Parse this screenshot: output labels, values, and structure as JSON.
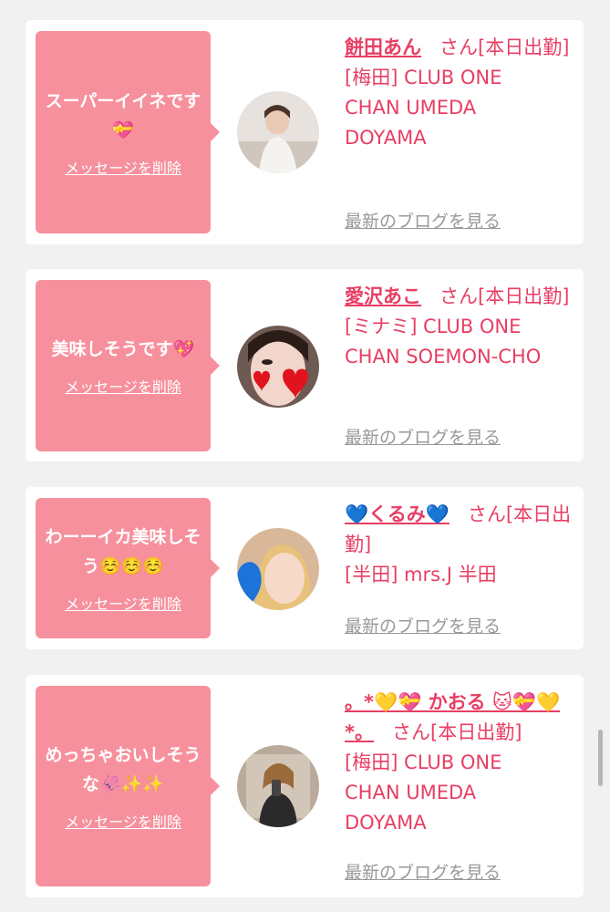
{
  "cards": [
    {
      "message": "スーパーイイネです💝",
      "delete_label": "メッセージを削除",
      "name": "餅田あん",
      "suffix": "さん[本日出勤]",
      "shop_lines": [
        "[梅田] CLUB ONE",
        "CHAN UMEDA",
        "DOYAMA"
      ],
      "blog_label": "最新のブログを見る"
    },
    {
      "message": "美味しそうです💖",
      "delete_label": "メッセージを削除",
      "name": "愛沢あこ",
      "suffix": "さん[本日出勤]",
      "shop_lines": [
        "[ミナミ] CLUB ONE",
        "CHAN SOEMON-CHO"
      ],
      "blog_label": "最新のブログを見る"
    },
    {
      "message": "わーーイカ美味しそう☺️☺️☺️",
      "delete_label": "メッセージを削除",
      "name": "💙くるみ💙",
      "suffix": "さん[本日出勤]",
      "shop_lines": [
        "[半田] mrs.J 半田"
      ],
      "blog_label": "最新のブログを見る"
    },
    {
      "message": "めっちゃおいしそうな🦑✨✨",
      "delete_label": "メッセージを削除",
      "name": "。*💛💝 かおる 🐱💝💛*。",
      "suffix": "さん[本日出勤]",
      "shop_lines": [
        "[梅田] CLUB ONE",
        "CHAN UMEDA",
        "DOYAMA"
      ],
      "blog_label": "最新のブログを見る"
    }
  ],
  "colors": {
    "accent_pink": "#f7909d",
    "name_red": "#e83e63",
    "link_gray": "#999999",
    "page_bg": "#f1f1f1"
  }
}
